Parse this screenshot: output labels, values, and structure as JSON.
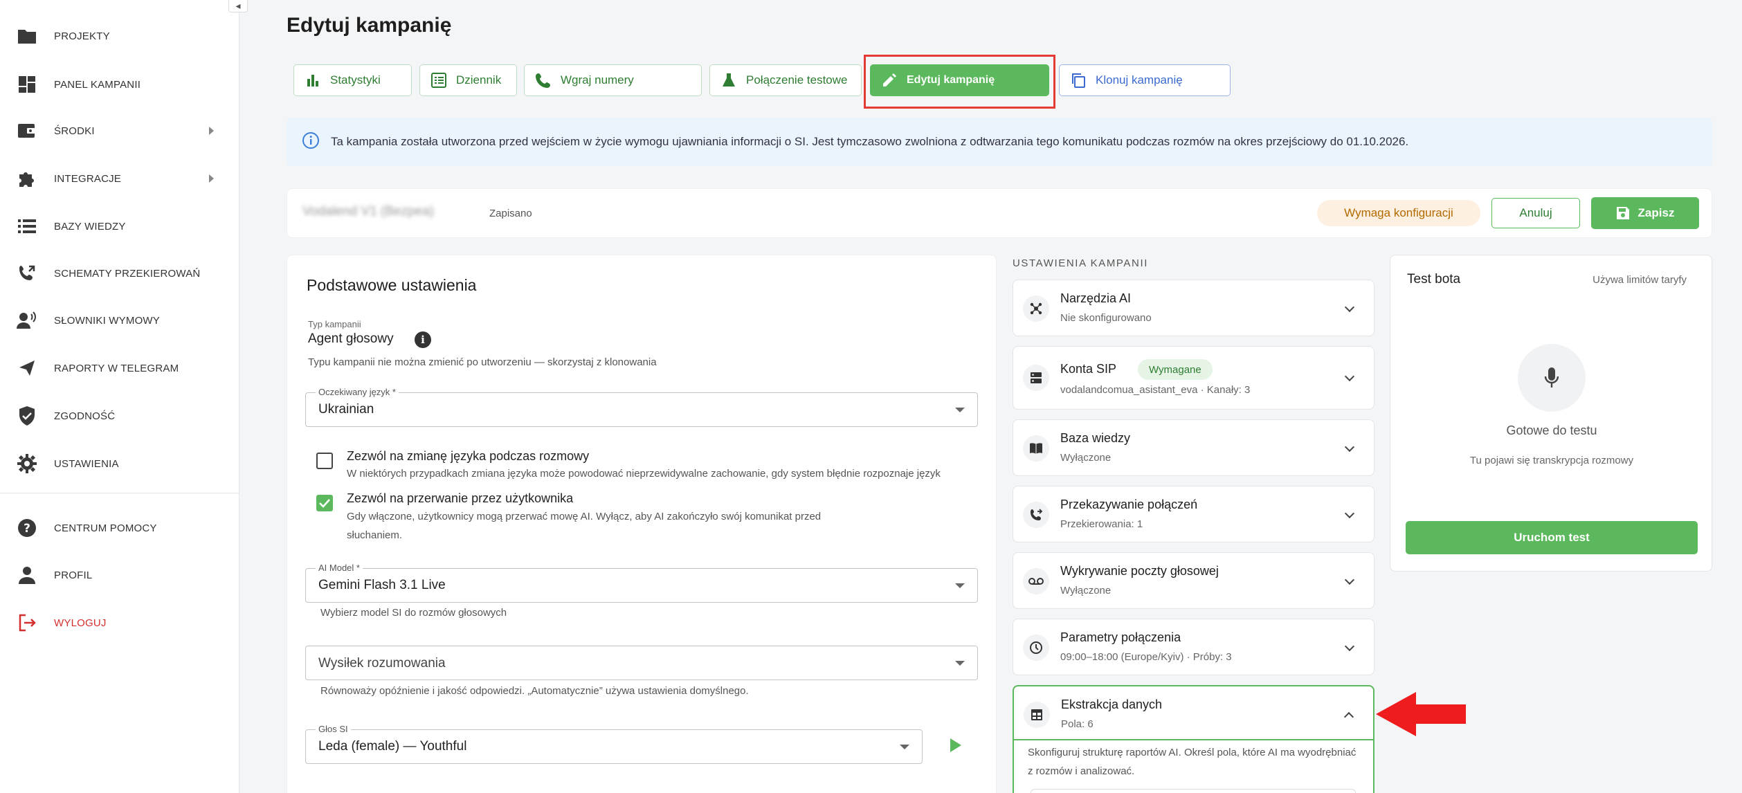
{
  "sidebar": {
    "items": [
      {
        "label": "PROJEKTY",
        "icon": "folder-icon"
      },
      {
        "label": "PANEL KAMPANII",
        "icon": "dashboard-icon"
      },
      {
        "label": "ŚRODKI",
        "icon": "wallet-icon"
      },
      {
        "label": "INTEGRACJE",
        "icon": "puzzle-icon"
      },
      {
        "label": "BAZY WIEDZY",
        "icon": "list-icon"
      },
      {
        "label": "SCHEMATY PRZEKIEROWAŃ",
        "icon": "call-transfer-icon"
      },
      {
        "label": "SŁOWNIKI WYMOWY",
        "icon": "speaking-person-icon"
      },
      {
        "label": "RAPORTY W TELEGRAM",
        "icon": "send-icon"
      },
      {
        "label": "ZGODNOŚĆ",
        "icon": "shield-check-icon"
      },
      {
        "label": "USTAWIENIA",
        "icon": "gear-icon"
      },
      {
        "label": "CENTRUM POMOCY",
        "icon": "help-icon"
      },
      {
        "label": "PROFIL",
        "icon": "person-icon"
      },
      {
        "label": "WYLOGUJ",
        "icon": "logout-icon"
      }
    ]
  },
  "page": {
    "title": "Edytuj kampanię"
  },
  "tabs": [
    {
      "label": "Statystyki",
      "icon": "bar-chart-icon"
    },
    {
      "label": "Dziennik",
      "icon": "list-box-icon"
    },
    {
      "label": "Wgraj numery",
      "icon": "phone-icon"
    },
    {
      "label": "Połączenie testowe",
      "icon": "flask-icon"
    },
    {
      "label": "Edytuj kampanię",
      "icon": "pencil-icon"
    },
    {
      "label": "Klonuj kampanię",
      "icon": "copy-icon"
    }
  ],
  "banner": {
    "text": "Ta kampania została utworzona przed wejściem w życie wymogu ujawniania informacji o SI. Jest tymczasowo zwolniona z odtwarzania tego komunikatu podczas rozmów na okres przejściowy do 01.10.2026."
  },
  "campaign": {
    "name": "Vodalend V1 (Bezpea)",
    "saved": "Zapisano",
    "status": "Wymaga konfiguracji",
    "cancel_label": "Anuluj",
    "save_label": "Zapisz"
  },
  "basic": {
    "heading": "Podstawowe ustawienia",
    "type_label": "Typ kampanii",
    "type_value": "Agent głosowy",
    "type_info": "i",
    "type_hint": "Typu kampanii nie można zmienić po utworzeniu — skorzystaj z klonowania",
    "language_label": "Oczekiwany język *",
    "language_value": "Ukrainian",
    "allow_lang_title": "Zezwól na zmianę języka podczas rozmowy",
    "allow_lang_desc": "W niektórych przypadkach zmiana języka może powodować nieprzewidywalne zachowanie, gdy system błędnie rozpoznaje język",
    "allow_lang_checked": false,
    "interrupt_title": "Zezwól na przerwanie przez użytkownika",
    "interrupt_desc_1": "Gdy włączone, użytkownicy mogą przerwać mowę AI. Wyłącz, aby AI zakończyło swój komunikat przed",
    "interrupt_desc_2": "słuchaniem.",
    "interrupt_checked": true,
    "model_label": "AI Model *",
    "model_value": "Gemini Flash 3.1 Live",
    "model_hint": "Wybierz model SI do rozmów głosowych",
    "reasoning_placeholder": "Wysiłek rozumowania",
    "reasoning_hint": "Równoważy opóźnienie i jakość odpowiedzi. „Automatycznie” używa ustawienia domyślnego.",
    "voice_label": "Głos SI",
    "voice_value": "Leda (female) — Youthful"
  },
  "settings": {
    "caption": "USTAWIENIA KAMPANII",
    "items": [
      {
        "title": "Narzędzia AI",
        "sub": "Nie skonfigurowano",
        "icon": "ai-tools-icon"
      },
      {
        "title": "Konta SIP",
        "sub": "vodalandcomua_asistant_eva · Kanały: 3",
        "icon": "server-icon",
        "chip": "Wymagane"
      },
      {
        "title": "Baza wiedzy",
        "sub": "Wyłączone",
        "icon": "book-icon"
      },
      {
        "title": "Przekazywanie połączeń",
        "sub": "Przekierowania: 1",
        "icon": "phone-forward-icon"
      },
      {
        "title": "Wykrywanie poczty głosowej",
        "sub": "Wyłączone",
        "icon": "voicemail-icon"
      },
      {
        "title": "Parametry połączenia",
        "sub": "09:00–18:00 (Europe/Kyiv) · Próby: 3",
        "icon": "clock-icon"
      },
      {
        "title": "Ekstrakcja danych",
        "sub": "Pola: 6",
        "icon": "table-icon"
      }
    ],
    "expanded_desc": "Skonfiguruj strukturę raportów AI. Określ pola, które AI ma wyodrębniać z rozmów i analizować."
  },
  "test": {
    "title": "Test bota",
    "limits": "Używa limitów taryfy",
    "ready": "Gotowe do testu",
    "hint": "Tu pojawi się transkrypcja rozmowy",
    "run_label": "Uruchom test"
  },
  "colors": {
    "accent": "#5cb85c",
    "highlight": "#e53935",
    "clone": "#3b6ad1",
    "logout": "#d32f2f"
  }
}
